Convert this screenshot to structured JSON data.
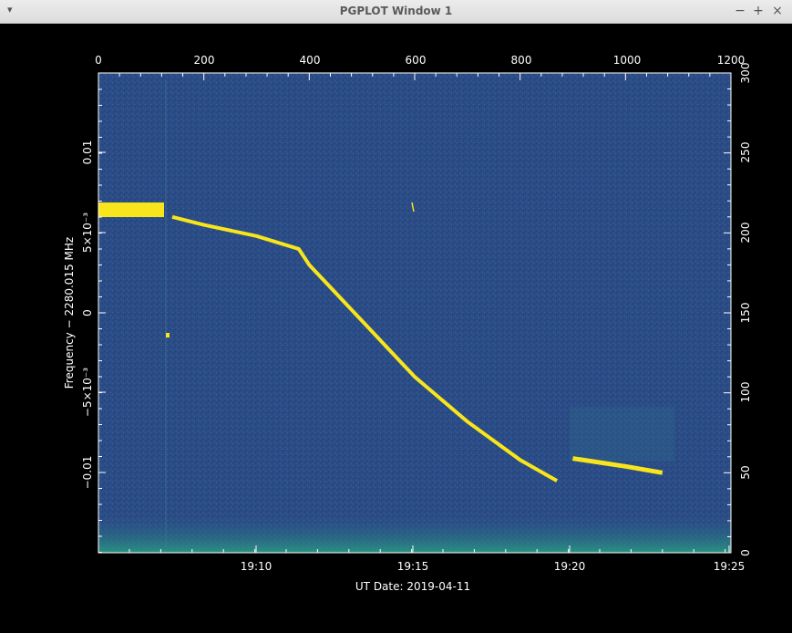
{
  "window": {
    "title": "PGPLOT Window 1",
    "menu_icon": "chevron-down-icon",
    "minimize_label": "−",
    "maximize_label": "+",
    "close_label": "×"
  },
  "plot": {
    "background_color": "#2b4c86",
    "signal_color": "#f8e51c",
    "noise_color": "#2a8f8a",
    "top_axis_ticks": [
      "0",
      "200",
      "400",
      "600",
      "800",
      "1000",
      "1200"
    ],
    "right_axis_ticks": [
      "0",
      "50",
      "100",
      "150",
      "200",
      "250",
      "300"
    ],
    "bottom_axis_ticks": [
      "19:10",
      "19:15",
      "19:20",
      "19:25"
    ],
    "left_axis_ticks": [
      "0.01",
      "5×10⁻³",
      "0",
      "−5×10⁻³",
      "−0.01"
    ],
    "xlabel": "UT Date: 2019-04-11",
    "ylabel": "Frequency − 2280.015 MHz"
  },
  "chart_data": {
    "type": "heatmap",
    "title": "",
    "xlabel": "UT Date: 2019-04-11",
    "ylabel": "Frequency − 2280.015 MHz",
    "x_time_ticks": [
      "19:10",
      "19:15",
      "19:20",
      "19:25"
    ],
    "x_index_range": [
      0,
      1200
    ],
    "y_index_range": [
      0,
      300
    ],
    "y_freq_offset_ticks": [
      0.01,
      0.005,
      0,
      -0.005,
      -0.01
    ],
    "signal_track": {
      "x_index": [
        0,
        130,
        140,
        200,
        300,
        380,
        400,
        500,
        600,
        700,
        800,
        870,
        900,
        1000,
        1070
      ],
      "y_index": [
        213,
        210,
        210,
        205,
        198,
        190,
        180,
        145,
        110,
        82,
        58,
        45,
        59,
        54,
        50
      ]
    }
  }
}
